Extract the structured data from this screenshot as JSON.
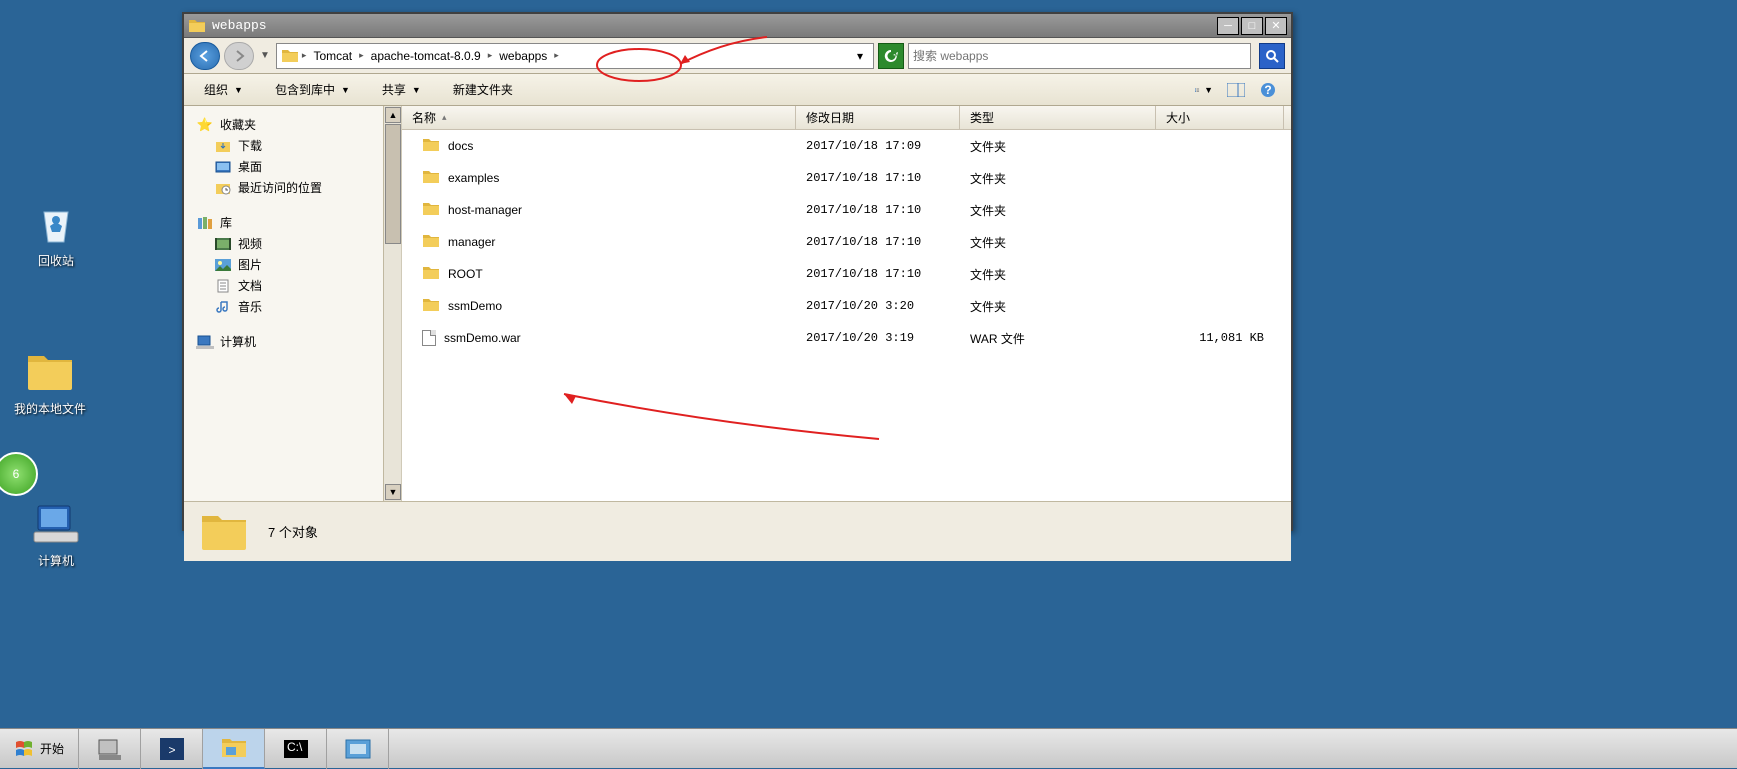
{
  "desktop": {
    "recycle_bin": "回收站",
    "my_local_files": "我的本地文件",
    "computer": "计算机"
  },
  "window": {
    "title": "webapps",
    "breadcrumb": [
      "Tomcat",
      "apache-tomcat-8.0.9",
      "webapps"
    ],
    "search_placeholder": "搜索 webapps",
    "toolbar": {
      "organize": "组织",
      "include_in_library": "包含到库中",
      "share": "共享",
      "new_folder": "新建文件夹"
    },
    "columns": {
      "name": "名称",
      "date": "修改日期",
      "type": "类型",
      "size": "大小"
    },
    "sidebar": {
      "favorites": "收藏夹",
      "downloads": "下载",
      "desktop": "桌面",
      "recent": "最近访问的位置",
      "library": "库",
      "videos": "视频",
      "pictures": "图片",
      "documents": "文档",
      "music": "音乐",
      "computer": "计算机"
    },
    "rows": [
      {
        "name": "docs",
        "date": "2017/10/18 17:09",
        "type": "文件夹",
        "size": "",
        "icon": "folder"
      },
      {
        "name": "examples",
        "date": "2017/10/18 17:10",
        "type": "文件夹",
        "size": "",
        "icon": "folder"
      },
      {
        "name": "host-manager",
        "date": "2017/10/18 17:10",
        "type": "文件夹",
        "size": "",
        "icon": "folder"
      },
      {
        "name": "manager",
        "date": "2017/10/18 17:10",
        "type": "文件夹",
        "size": "",
        "icon": "folder"
      },
      {
        "name": "ROOT",
        "date": "2017/10/18 17:10",
        "type": "文件夹",
        "size": "",
        "icon": "folder"
      },
      {
        "name": "ssmDemo",
        "date": "2017/10/20 3:20",
        "type": "文件夹",
        "size": "",
        "icon": "folder"
      },
      {
        "name": "ssmDemo.war",
        "date": "2017/10/20 3:19",
        "type": "WAR 文件",
        "size": "11,081 KB",
        "icon": "file"
      }
    ],
    "status": "7 个对象"
  },
  "taskbar": {
    "start": "开始"
  },
  "clock_badge": "6"
}
